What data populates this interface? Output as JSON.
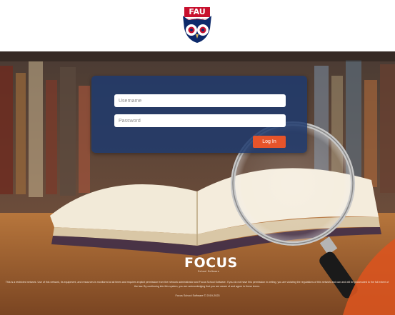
{
  "header": {
    "logo_text": "FAU",
    "logo_subtext": "FLORIDA ATLANTIC"
  },
  "login": {
    "username_placeholder": "Username",
    "password_placeholder": "Password",
    "login_button": "Log In"
  },
  "footer": {
    "brand_word": "FOCUS",
    "brand_tagline": "School Software",
    "disclaimer": "This is a restricted network. Use of this network, its equipment, and resources is monitored at all times and requires explicit permission from the network administrator and Focus School Software. If you do not have this permission in writing, you are violating the regulations of this network and can and will be prosecuted to the full extent of the law. By continuing into this system, you are acknowledging that you are aware of and agree to these terms.",
    "copyright": "Focus School Software © 2019-2023"
  },
  "colors": {
    "panel": "#203a6e",
    "login_button": "#e6542a",
    "fau_blue": "#0d2a6b",
    "fau_red": "#c8102e"
  }
}
